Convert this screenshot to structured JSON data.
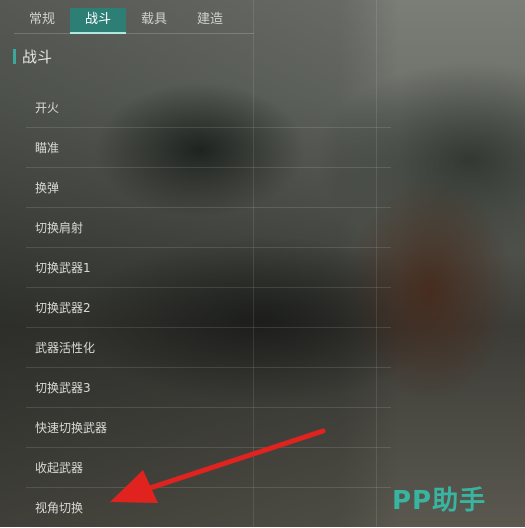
{
  "tabs": [
    {
      "label": "常规",
      "active": false
    },
    {
      "label": "战斗",
      "active": true
    },
    {
      "label": "载具",
      "active": false
    },
    {
      "label": "建造",
      "active": false
    }
  ],
  "section": {
    "title": "战斗"
  },
  "controls": [
    {
      "label": "开火"
    },
    {
      "label": "瞄准"
    },
    {
      "label": "换弹"
    },
    {
      "label": "切换肩射"
    },
    {
      "label": "切换武器1"
    },
    {
      "label": "切换武器2"
    },
    {
      "label": "武器活性化"
    },
    {
      "label": "切换武器3"
    },
    {
      "label": "快速切换武器"
    },
    {
      "label": "收起武器"
    },
    {
      "label": "视角切换"
    }
  ],
  "watermark": {
    "text": "PP助手"
  },
  "colors": {
    "accent": "#2d7f76",
    "arrow": "#e0231f",
    "watermark": "#39b4a0"
  }
}
